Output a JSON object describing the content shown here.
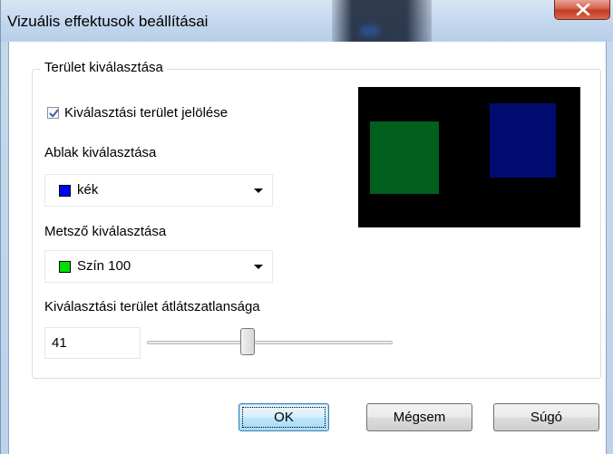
{
  "window": {
    "title": "Vizuális effektusok beállításai"
  },
  "group": {
    "label": "Terület kiválasztása"
  },
  "checkbox": {
    "label": "Kiválasztási terület jelölése",
    "checked": true
  },
  "window_select": {
    "label": "Ablak kiválasztása",
    "value": "kék",
    "swatch_color": "#0000ff"
  },
  "clip_select": {
    "label": "Metsző kiválasztása",
    "value": "Szín 100",
    "swatch_color": "#00e000"
  },
  "opacity": {
    "label": "Kiválasztási terület átlátszatlansága",
    "value": "41",
    "slider_fraction": 0.41
  },
  "preview": {
    "background": "#000000",
    "window_rect_color": "#005f1c",
    "clip_rect_color": "#000b70"
  },
  "buttons": {
    "ok": "OK",
    "cancel": "Mégsem",
    "help": "Súgó"
  },
  "icons": {
    "close": "close-icon",
    "check": "check-icon",
    "dropdown": "chevron-down-icon"
  }
}
